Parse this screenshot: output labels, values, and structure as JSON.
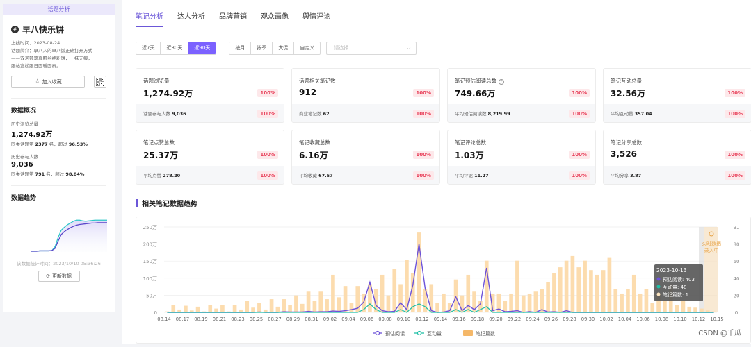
{
  "sidebar": {
    "banner": "话题分析",
    "topic_icon_glyph": "#",
    "title": "早八快乐饼",
    "online_time": "上线时间：2023-08-24",
    "intro_1": "话题简介：早八人的早八饭正确打开方式",
    "intro_2": "——双河翡翠真肌丝裙粉饼，一抹无痕，",
    "intro_3": "服帖宽松服日面暖面泰。",
    "fav_label": "加入收藏",
    "overview_title": "数据概况",
    "hist_views_label": "历史浏览总量",
    "hist_views_value": "1,274.92万",
    "hist_views_sub_a": "同类话题第",
    "hist_views_rank": "2377",
    "hist_views_sub_b": "名，超过",
    "hist_views_pct": "96.53%",
    "hist_part_label": "历史参与人数",
    "hist_part_value": "9,036",
    "hist_part_sub_a": "同类话题第",
    "hist_part_rank": "791",
    "hist_part_sub_b": "名，超过",
    "hist_part_pct": "98.84%",
    "trend_title": "数据趋势",
    "stat_time": "该数据统计时间：2023/10/10 05:36:26",
    "update_label": "更新数据"
  },
  "tabs": [
    "笔记分析",
    "达人分析",
    "品牌营销",
    "观众画像",
    "舆情评论"
  ],
  "filters": {
    "range": [
      "近7天",
      "近30天",
      "近90天"
    ],
    "range_active": 2,
    "period": [
      "按月",
      "按季",
      "大促",
      "自定义"
    ],
    "select_placeholder": "请选择"
  },
  "cards": [
    {
      "title": "话题浏览量",
      "value": "1,274.92万",
      "pct": "100%",
      "sub_label": "话题参与人数",
      "sub_value": "9,036",
      "pct2": "100%"
    },
    {
      "title": "话题相关笔记数",
      "value": "912",
      "pct": "100%",
      "sub_label": "商业笔记数",
      "sub_value": "62",
      "pct2": "100%"
    },
    {
      "title": "笔记预估阅读总数",
      "value": "749.66万",
      "pct": "100%",
      "sub_label": "平均预估阅读数",
      "sub_value": "8,219.99",
      "pct2": "100%",
      "info": true
    },
    {
      "title": "笔记互动总量",
      "value": "32.56万",
      "pct": "100%",
      "sub_label": "平均互动量",
      "sub_value": "357.04",
      "pct2": "100%"
    },
    {
      "title": "笔记点赞总数",
      "value": "25.37万",
      "pct": "100%",
      "sub_label": "平均点赞",
      "sub_value": "278.20",
      "pct2": "100%"
    },
    {
      "title": "笔记收藏总数",
      "value": "6.16万",
      "pct": "100%",
      "sub_label": "平均收藏",
      "sub_value": "67.57",
      "pct2": "100%"
    },
    {
      "title": "笔记评论总数",
      "value": "1.03万",
      "pct": "100%",
      "sub_label": "平均评论",
      "sub_value": "11.27",
      "pct2": "100%"
    },
    {
      "title": "笔记分享总数",
      "value": "3,526",
      "pct": "100%",
      "sub_label": "平均分享",
      "sub_value": "3.87",
      "pct2": "100%"
    }
  ],
  "section_title": "相关笔记数据趋势",
  "tooltip": {
    "date": "2023-10-13",
    "l1": "预估阅读: 403",
    "l2": "互动量: 48",
    "l3": "笔记篇数: 1"
  },
  "realtime_note_1": "实时数据",
  "realtime_note_2": "录入中",
  "watermark": "CSDN @千瓜",
  "colors": {
    "accent": "#6b57d8",
    "read": "#6c52d9",
    "interact": "#1fbfa6",
    "notes": "#fcdcae"
  },
  "chart_data": {
    "type": "bar+line",
    "x_ticks": [
      "08.14",
      "08.17",
      "08.19",
      "08.21",
      "08.23",
      "08.25",
      "08.27",
      "08.29",
      "08.31",
      "09.02",
      "09.04",
      "09.06",
      "09.08",
      "09.10",
      "09.12",
      "09.14",
      "09.16",
      "09.18",
      "09.20",
      "09.22",
      "09.24",
      "09.26",
      "09.28",
      "09.30",
      "10.02",
      "10.04",
      "10.06",
      "10.08",
      "10.10",
      "10.12",
      "10.15"
    ],
    "left_ticks": [
      "0",
      "50万",
      "100万",
      "150万",
      "200万",
      "250万"
    ],
    "right_ticks": [
      "0",
      "20",
      "40",
      "60",
      "80",
      "91"
    ],
    "left_max": 2500000,
    "right_max": 91,
    "legend": [
      "预估阅读",
      "互动量",
      "笔记篇数"
    ],
    "notes": [
      1,
      8,
      3,
      7,
      2,
      6,
      1,
      8,
      4,
      8,
      1,
      8,
      3,
      12,
      5,
      10,
      3,
      14,
      6,
      14,
      8,
      18,
      9,
      22,
      12,
      22,
      14,
      40,
      16,
      28,
      10,
      28,
      20,
      30,
      25,
      40,
      18,
      46,
      30,
      56,
      42,
      85,
      25,
      30,
      10,
      20,
      10,
      35,
      18,
      40,
      22,
      12,
      55,
      20,
      20,
      12,
      20,
      55,
      18,
      20,
      22,
      25,
      32,
      42,
      48,
      55,
      60,
      48,
      55,
      45,
      40,
      45,
      58,
      25,
      20,
      25,
      40,
      20,
      25,
      10,
      20,
      12,
      30,
      8,
      12,
      6,
      5,
      4,
      2,
      1
    ],
    "reads": [
      0,
      0,
      0,
      0,
      0,
      0,
      0,
      0,
      0,
      0,
      0,
      0,
      0,
      0,
      0,
      1,
      0,
      0,
      0,
      2,
      1,
      1,
      1,
      3,
      1,
      2,
      2,
      4,
      3,
      5,
      8,
      12,
      30,
      88,
      20,
      5,
      2,
      3,
      28,
      8,
      80,
      200,
      70,
      5,
      0,
      1,
      5,
      45,
      5,
      20,
      8,
      25,
      130,
      5,
      10,
      2,
      3,
      5,
      0,
      2,
      0,
      8,
      1,
      2,
      0,
      5,
      0,
      0,
      0,
      0,
      0,
      0,
      0,
      0,
      0,
      0,
      0,
      0,
      0,
      0,
      0,
      0,
      0,
      0,
      0,
      0,
      0,
      0,
      0,
      0
    ],
    "interactions": [
      0,
      0,
      0,
      0,
      0,
      0,
      0,
      0,
      0,
      0,
      0,
      0,
      0,
      0,
      0,
      0,
      0,
      0,
      0,
      0,
      0,
      0,
      0,
      0,
      0,
      0,
      0,
      0,
      0,
      0,
      0,
      0,
      1,
      3,
      1,
      0,
      0,
      0,
      1,
      0,
      2,
      3,
      2,
      0,
      0,
      0,
      0,
      1,
      0,
      1,
      0,
      1,
      2,
      0,
      0,
      0,
      0,
      0,
      0,
      0,
      0,
      0,
      0,
      0,
      0,
      0,
      0,
      0,
      0,
      0,
      0,
      0,
      0,
      0,
      0,
      0,
      0,
      0,
      0,
      0,
      0,
      0,
      0,
      0,
      0,
      0,
      0,
      0,
      0,
      0
    ]
  },
  "trend_chart": {
    "type": "line",
    "series_a": [
      2,
      2,
      2,
      3,
      3,
      3,
      3,
      4,
      15,
      40,
      60,
      68,
      75,
      80,
      85,
      88,
      88,
      86,
      85,
      86,
      87,
      88,
      88,
      88,
      88,
      88
    ],
    "series_b": [
      2,
      2,
      2,
      3,
      3,
      3,
      3,
      4,
      10,
      30,
      48,
      56,
      62,
      67,
      71,
      74,
      76,
      77,
      78,
      79,
      80,
      80,
      81,
      81,
      81,
      81
    ]
  }
}
